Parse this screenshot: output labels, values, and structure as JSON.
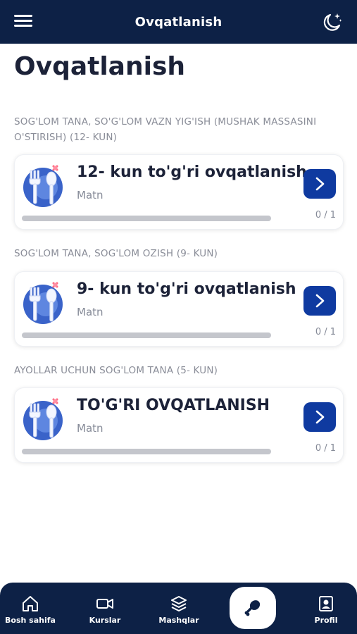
{
  "header": {
    "title": "Ovqatlanish",
    "menu_icon": "hamburger-menu-icon",
    "theme_icon": "moon-stars-icon"
  },
  "page": {
    "title": "Ovqatlanish"
  },
  "sections": [
    {
      "label": "SOG'LOM TANA, SO'G'LOM VAZN YIG'ISH (MUSHAK MASSASINI O'STIRISH) (12- KUN)",
      "card": {
        "title": "12- kun to'g'ri ovqatlanish",
        "type": "Matn",
        "count": "0 / 1",
        "progress": 0
      }
    },
    {
      "label": "SOG'LOM TANA, SOG'LOM OZISH (9- KUN)",
      "card": {
        "title": "9- kun to'g'ri ovqatlanish",
        "type": "Matn",
        "count": "0 / 1",
        "progress": 0
      }
    },
    {
      "label": "AYOLLAR UCHUN SOG'LOM TANA (5- KUN)",
      "card": {
        "title": "TO'G'RI OVQATLANISH",
        "type": "Matn",
        "count": "0 / 1",
        "progress": 0
      }
    }
  ],
  "bottom_nav": {
    "items": [
      {
        "label": "Bosh sahifa",
        "icon": "home-icon"
      },
      {
        "label": "Kurslar",
        "icon": "video-camera-icon"
      },
      {
        "label": "Mashqlar",
        "icon": "layers-icon"
      },
      {
        "label": "",
        "icon": "drumstick-icon",
        "active": true
      },
      {
        "label": "Profil",
        "icon": "profile-icon"
      }
    ]
  },
  "colors": {
    "header_bg": "#0d2146",
    "accent": "#0f3aa0",
    "progress_track": "#c4c6cc",
    "text_dark": "#1c2238",
    "text_muted": "#8a8d98"
  }
}
